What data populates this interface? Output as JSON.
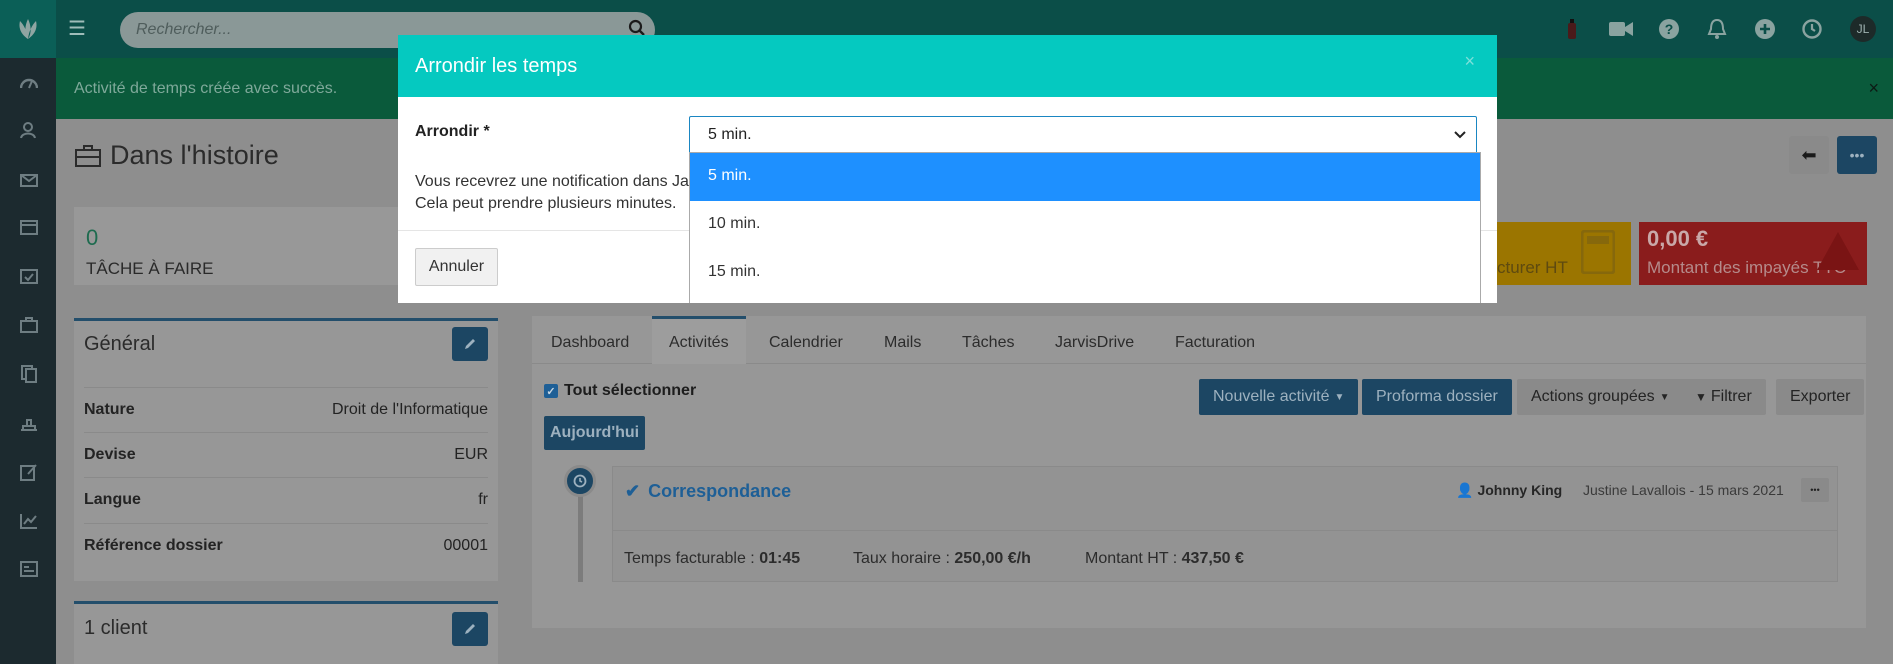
{
  "topbar": {
    "search_placeholder": "Rechercher...",
    "avatar_initials": "JL"
  },
  "alert": {
    "text": "Activité de temps créée avec succès.",
    "close": "×"
  },
  "page": {
    "title": "Dans l'histoire"
  },
  "kpis": [
    {
      "value": "0",
      "label": "TÂCHE À FAIRE"
    },
    {
      "value": "",
      "label": "cturer HT"
    },
    {
      "value": "0,00 €",
      "label": "Montant des impayés TTC"
    }
  ],
  "general": {
    "title": "Général",
    "rows": [
      {
        "label": "Nature",
        "value": "Droit de l'Informatique"
      },
      {
        "label": "Devise",
        "value": "EUR"
      },
      {
        "label": "Langue",
        "value": "fr"
      },
      {
        "label": "Référence dossier",
        "value": "00001"
      }
    ]
  },
  "clients": {
    "title": "1 client"
  },
  "tabs": [
    "Dashboard",
    "Activités",
    "Calendrier",
    "Mails",
    "Tâches",
    "JarvisDrive",
    "Facturation"
  ],
  "activities": {
    "select_all": "Tout sélectionner",
    "today": "Aujourd'hui",
    "buttons": {
      "new": "Nouvelle activité",
      "proforma": "Proforma dossier",
      "grouped": "Actions groupées",
      "filter": "Filtrer",
      "export": "Exporter"
    },
    "item": {
      "title": "Correspondance",
      "user": "Johnny King",
      "meta": "Justine Lavallois - 15 mars 2021",
      "time_label": "Temps facturable :",
      "time_value": "01:45",
      "rate_label": "Taux horaire :",
      "rate_value": "250,00 €/h",
      "amount_label": "Montant HT :",
      "amount_value": "437,50 €"
    }
  },
  "modal": {
    "title": "Arrondir les temps",
    "close": "×",
    "field_label": "Arrondir *",
    "selected": "5 min.",
    "options": [
      "5 min.",
      "10 min.",
      "15 min."
    ],
    "notice_line1": "Vous recevrez une notification dans Jar",
    "notice_line2": "Cela peut prendre plusieurs minutes.",
    "cancel": "Annuler"
  },
  "colors": {
    "teal": "#05c9c0",
    "selected_option": "#1e90ff",
    "nav_blue": "#1c4663"
  }
}
